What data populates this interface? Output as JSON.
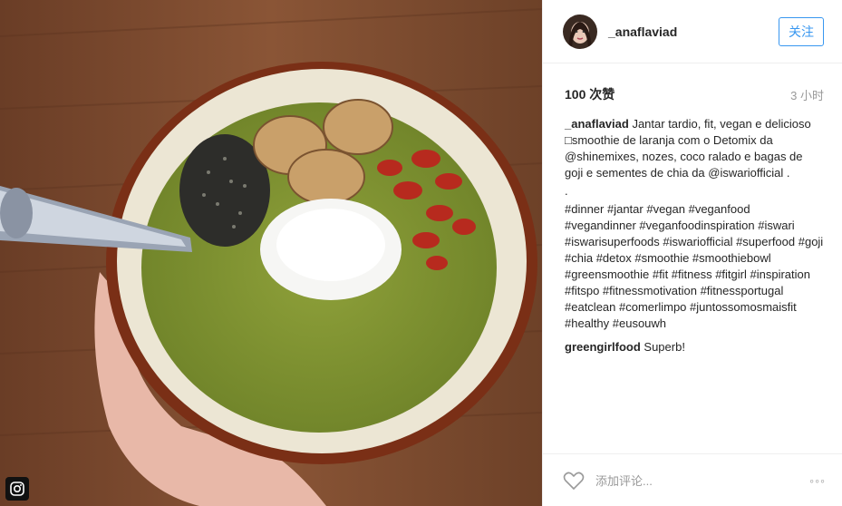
{
  "post": {
    "username": "_anaflaviad",
    "follow_label": "关注",
    "likes": "100 次赞",
    "time": "3 小时",
    "caption_user": "_anaflaviad",
    "caption_text": "Jantar tardio, fit, vegan e delicioso □smoothie de laranja com o Detomix da @shinemixes, nozes, coco ralado e bagas de goji e sementes de chia da @iswariofficial .",
    "caption_dot": ".",
    "hashtags": "#dinner #jantar #vegan #veganfood #vegandinner #veganfoodinspiration #iswari #iswarisuperfoods #iswariofficial #superfood #goji #chia #detox #smoothie #smoothiebowl #greensmoothie #fit #fitness #fitgirl #inspiration #fitspo #fitnessmotivation #fitnessportugal #eatclean #comerlimpo #juntossomosmaisfit #healthy #eusouwh",
    "comment_user": "greengirlfood",
    "comment_text": "Superb!",
    "add_comment_placeholder": "添加评论...",
    "more_label": "◦◦◦"
  },
  "icons": {
    "heart": "heart-icon",
    "more": "more-options-icon",
    "instagram": "instagram-badge-icon"
  },
  "colors": {
    "accent": "#3897f0",
    "text": "#262626",
    "muted": "#999999"
  }
}
